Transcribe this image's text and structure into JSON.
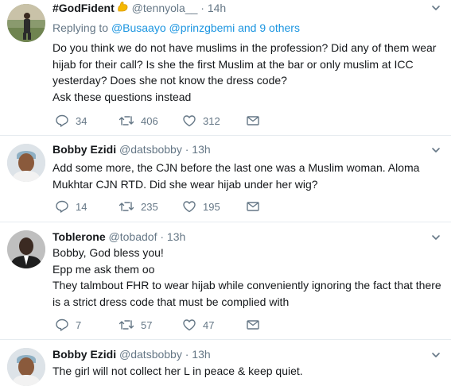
{
  "tweets": [
    {
      "name": "#GodFident",
      "handle": "@tennyola__",
      "time": "14h",
      "replying_prefix": "Replying to",
      "replying_users": "@Busaayo @prinzgbemi",
      "replying_suffix": "and 9 others",
      "lines": [
        "Do you think we do not have muslims in the profession? Did any of them wear",
        "hijab for their call? Is she the first Muslim at the bar or only muslim at ICC",
        "yesterday? Does she not know the dress code?",
        "Ask these questions instead"
      ],
      "replies": "34",
      "retweets": "406",
      "likes": "312"
    },
    {
      "name": "Bobby Ezidi",
      "handle": "@datsbobby",
      "time": "13h",
      "lines": [
        "Add some more, the CJN before the last one was a Muslim woman. Aloma",
        "Mukhtar CJN RTD. Did she wear hijab under her wig?"
      ],
      "replies": "14",
      "retweets": "235",
      "likes": "195"
    },
    {
      "name": "Toblerone",
      "handle": "@tobadof",
      "time": "13h",
      "lines": [
        "Bobby, God bless you!",
        "Epp me ask them oo",
        "They talmbout FHR to wear hijab while conveniently ignoring the fact that there",
        "is a strict dress code that must be complied with"
      ],
      "replies": "7",
      "retweets": "57",
      "likes": "47"
    },
    {
      "name": "Bobby Ezidi",
      "handle": "@datsbobby",
      "time": "13h",
      "lines": [
        "The girl will not collect her L in peace & keep quiet."
      ]
    }
  ],
  "colors": {
    "text": "#14171a",
    "secondary": "#657786",
    "link": "#1b95e0",
    "divider": "#e6ecf0",
    "emoji": "#f5b800"
  },
  "icons": [
    "reply-icon",
    "retweet-icon",
    "like-icon",
    "message-icon",
    "chevron-down-icon",
    "flexed-biceps-emoji"
  ]
}
